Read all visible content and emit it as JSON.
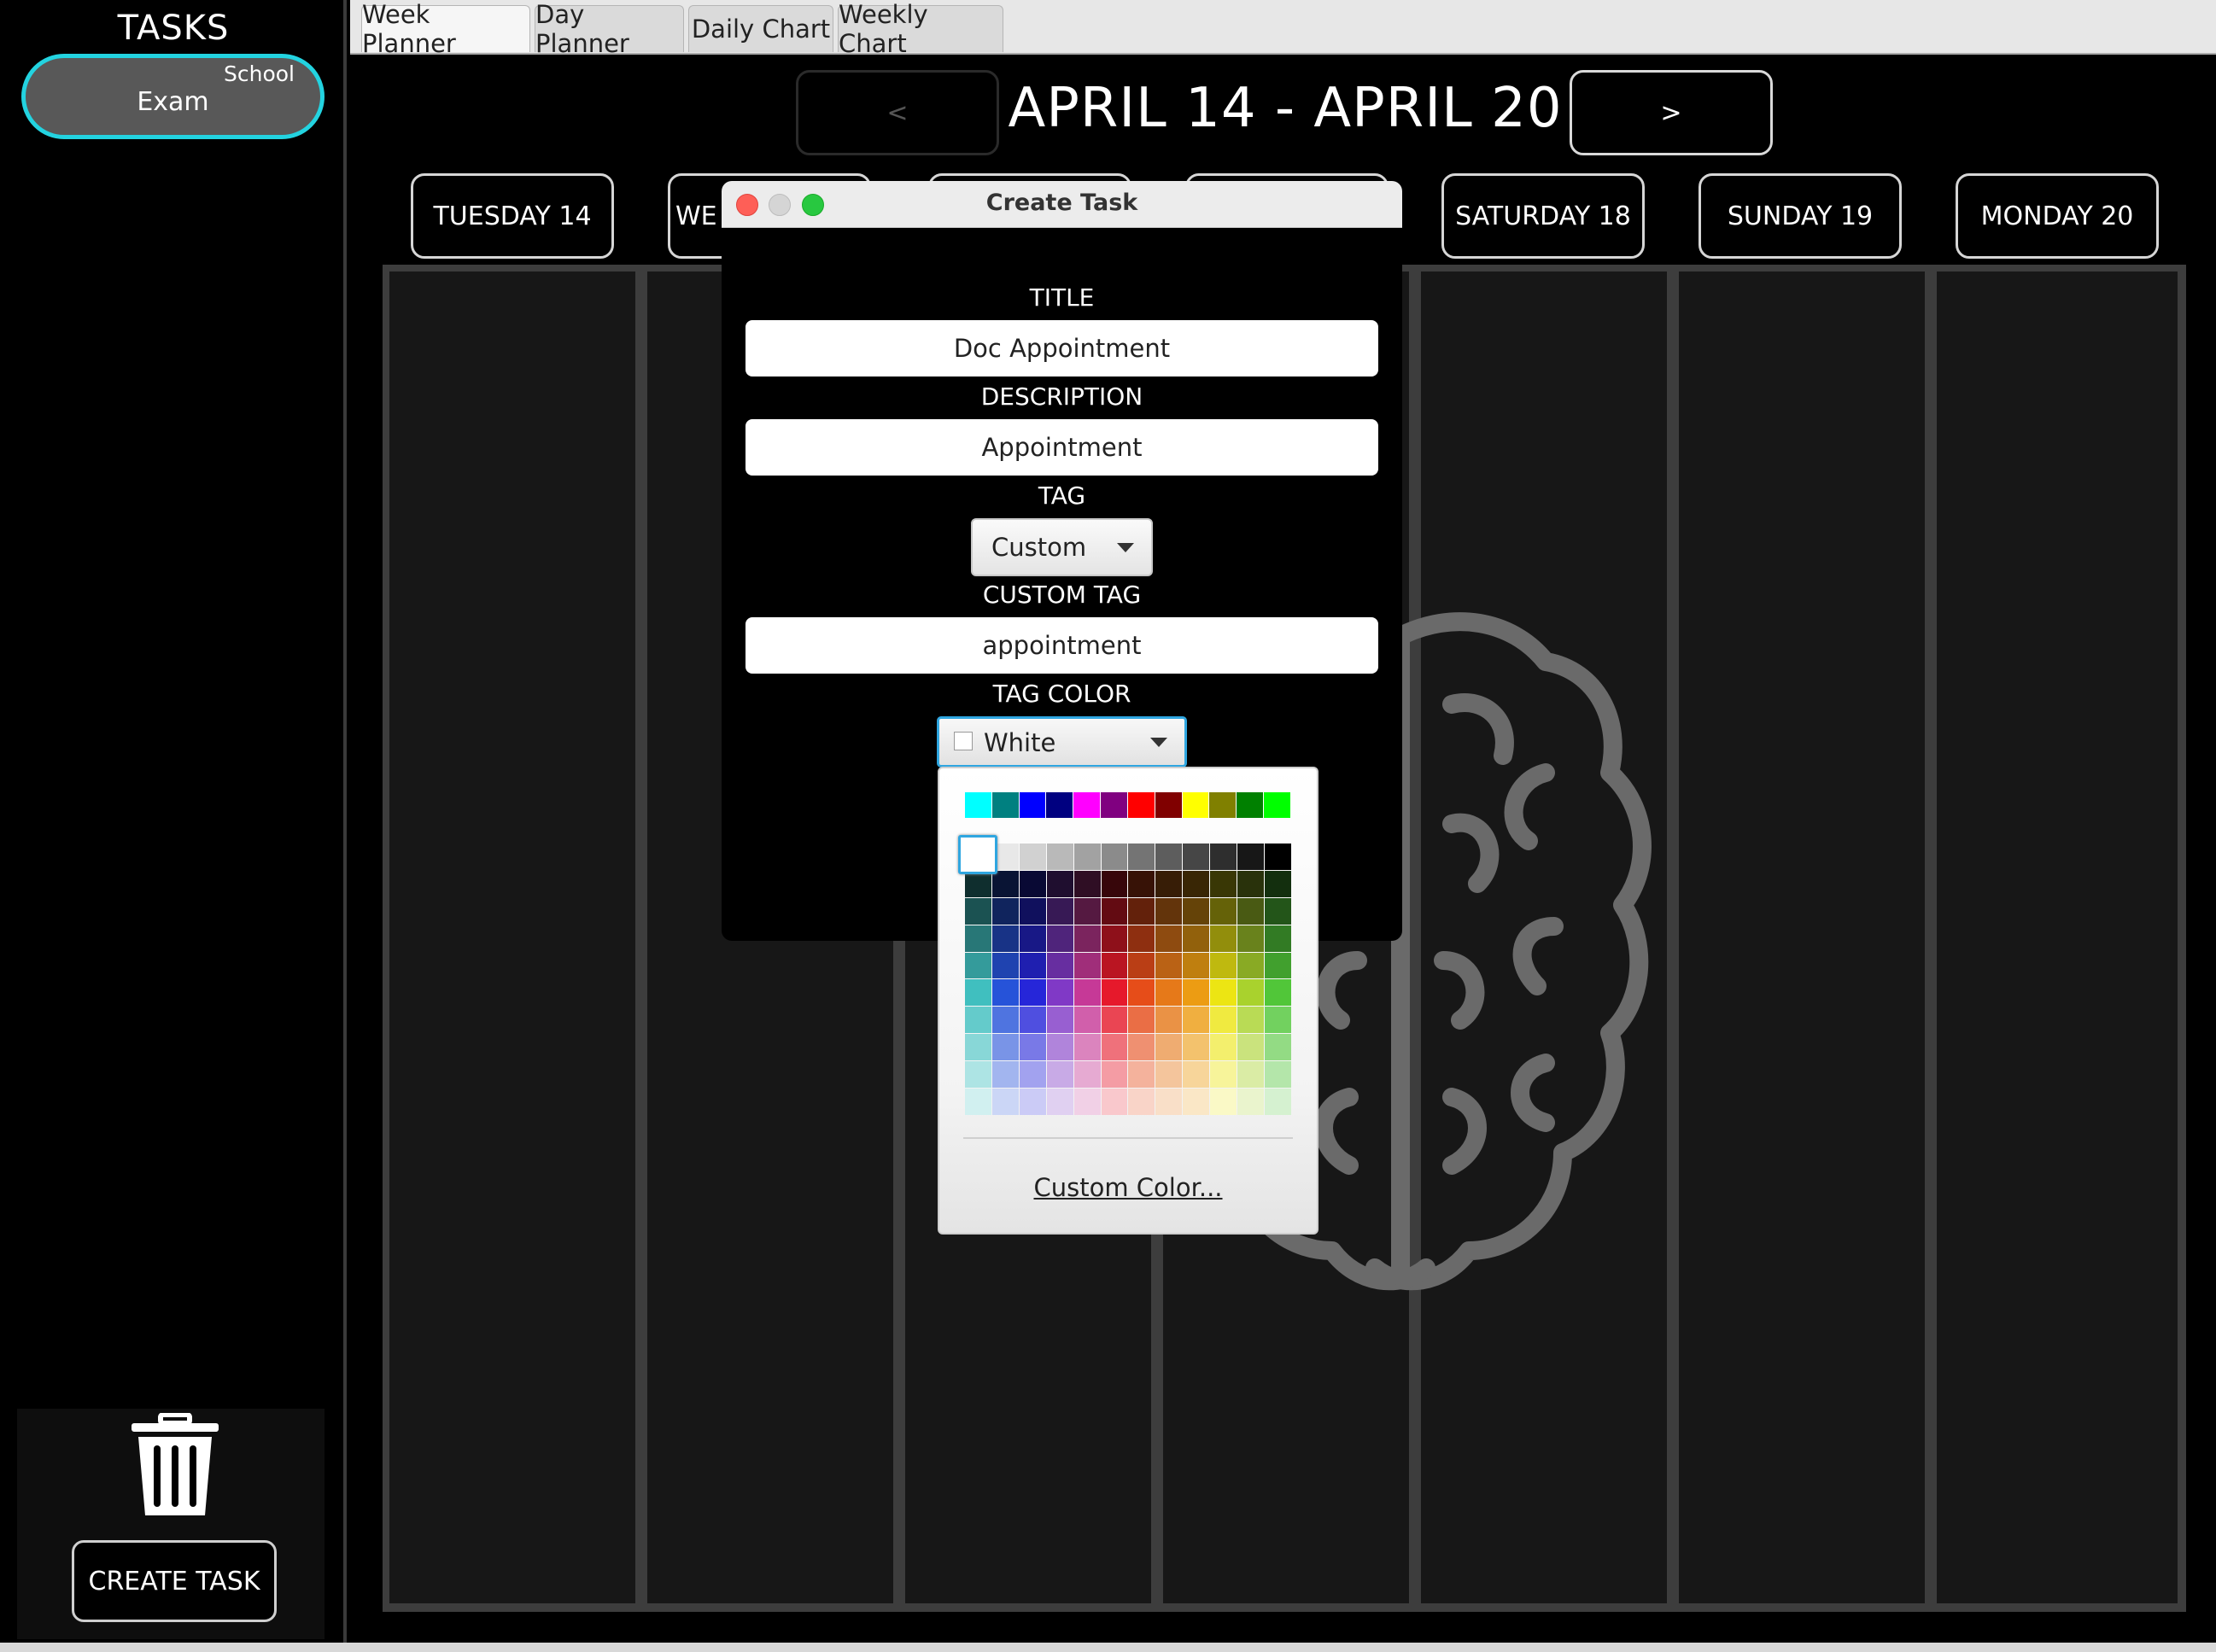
{
  "sidebar": {
    "title": "TASKS",
    "tasks": [
      {
        "tag": "School",
        "title": "Exam"
      }
    ],
    "create_task_label": "CREATE TASK"
  },
  "tabs": [
    {
      "label": "Week Planner",
      "active": true
    },
    {
      "label": "Day Planner",
      "active": false
    },
    {
      "label": "Daily Chart",
      "active": false
    },
    {
      "label": "Weekly Chart",
      "active": false
    }
  ],
  "week": {
    "prev_label": "<",
    "next_label": ">",
    "range": "APRIL 14 - APRIL 20",
    "days": [
      "TUESDAY 14",
      "WE",
      "",
      "",
      "SATURDAY 18",
      "SUNDAY 19",
      "MONDAY 20"
    ]
  },
  "dialog": {
    "title": "Create Task",
    "title_label": "TITLE",
    "title_value": "Doc Appointment",
    "description_label": "DESCRIPTION",
    "description_value": "Appointment",
    "tag_label": "TAG",
    "tag_value": "Custom",
    "custom_tag_label": "CUSTOM TAG",
    "custom_tag_value": "appointment",
    "tag_color_label": "TAG COLOR",
    "tag_color_value": "White"
  },
  "color_popup": {
    "custom_color_label": "Custom Color...",
    "top_row": [
      "#00ffff",
      "#008080",
      "#0000ff",
      "#000080",
      "#ff00ff",
      "#800080",
      "#ff0000",
      "#800000",
      "#ffff00",
      "#808000",
      "#008000",
      "#00ff00"
    ]
  },
  "colors": {
    "accent_cyan": "#23d3e0",
    "focus_blue": "#2fa6e0",
    "column_bg": "#171717"
  }
}
